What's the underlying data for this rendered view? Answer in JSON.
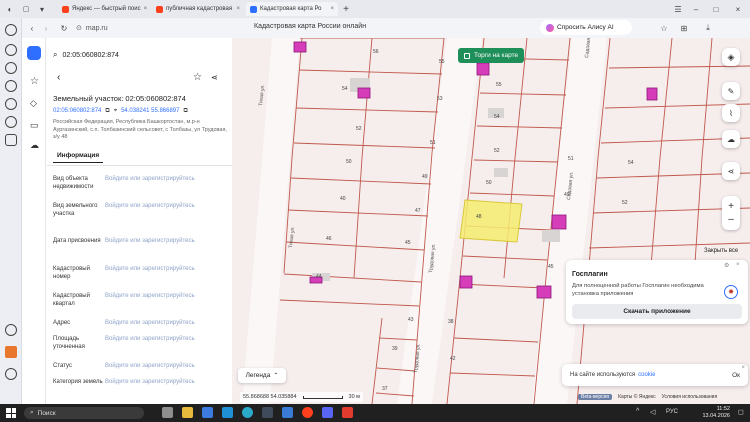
{
  "browser": {
    "tabs": [
      {
        "label": "Яндекс — быстрый поис",
        "active": false,
        "color": "#fc3f1d"
      },
      {
        "label": "публичная кадастровая",
        "active": false,
        "color": "#fc3f1d"
      },
      {
        "label": "Кадастровая карта Ро",
        "active": true,
        "color": "#2f6fff"
      }
    ],
    "new_tab": "+",
    "url": "map.ru",
    "page_title": "Кадастровая карта России онлайн",
    "alice": "Спросить Алису AI"
  },
  "panel": {
    "search_value": "02:05:060802:874",
    "title": "Земельный участок: 02:05:060802:874",
    "cad_number": "02:05:060802:874",
    "coords": "54.038241 55.866897",
    "address": "Российская Федерация, Республика Башкортостан, м.р-н Аургазинский, с.п. Толбазинский сельсовет, с Толбазы, ул Трудовая, з/у 48",
    "tab_info": "Информация",
    "fields": [
      {
        "label": "Вид объекта недвижимости",
        "value": "Войдите или зарегистрируйтесь"
      },
      {
        "label": "Вид земельного участка",
        "value": "Войдите или зарегистрируйтесь"
      },
      {
        "label": "Дата присвоения",
        "value": "Войдите или зарегистрируйтесь"
      },
      {
        "label": "Кадастровый номер",
        "value": "Войдите или зарегистрируйтесь"
      },
      {
        "label": "Кадастровый квартал",
        "value": "Войдите или зарегистрируйтесь"
      },
      {
        "label": "Адрес",
        "value": "Войдите или зарегистрируйтесь"
      },
      {
        "label": "Площадь уточненная",
        "value": "Войдите или зарегистрируйтесь"
      },
      {
        "label": "Статус",
        "value": "Войдите или зарегистрируйтесь"
      },
      {
        "label": "Категория земель",
        "value": "Войдите или зарегистрируйтесь"
      }
    ]
  },
  "map": {
    "trade_button": "Торги на карте",
    "legend": "Легенда",
    "scale_coords": "55.868688  54.035884",
    "scale": "30 м",
    "streets": [
      "Тихая ул.",
      "Трудовая ул.",
      "Садовая ул."
    ],
    "parcel_numbers": [
      "56",
      "55",
      "53",
      "54",
      "52",
      "51",
      "50",
      "49",
      "48",
      "47",
      "46",
      "45",
      "44",
      "43",
      "42",
      "40",
      "39",
      "38",
      "37",
      "57",
      "55",
      "54",
      "52",
      "50",
      "49",
      "51",
      "45"
    ],
    "close_all": "Закрыть все",
    "gosplagin": {
      "title": "Госплагин",
      "text": "Для полноценной работы Госплагин необходима установка приложения",
      "button": "Скачать приложение"
    },
    "cookie": {
      "text": "На сайте используются",
      "link": "cookie",
      "ok": "Ок"
    },
    "footer": [
      "Beta-версия",
      "Карты © Яндекс",
      "Условия использования"
    ]
  },
  "taskbar": {
    "search": "Поиск",
    "lang": "РУС",
    "time": "11:52",
    "date": "13.04.2026"
  },
  "colors": {
    "accent": "#2f6fff",
    "trade": "#1f8f5a",
    "parcel_line": "#c0584c",
    "selected": "#f4ec6e",
    "building": "#c81ea8"
  }
}
